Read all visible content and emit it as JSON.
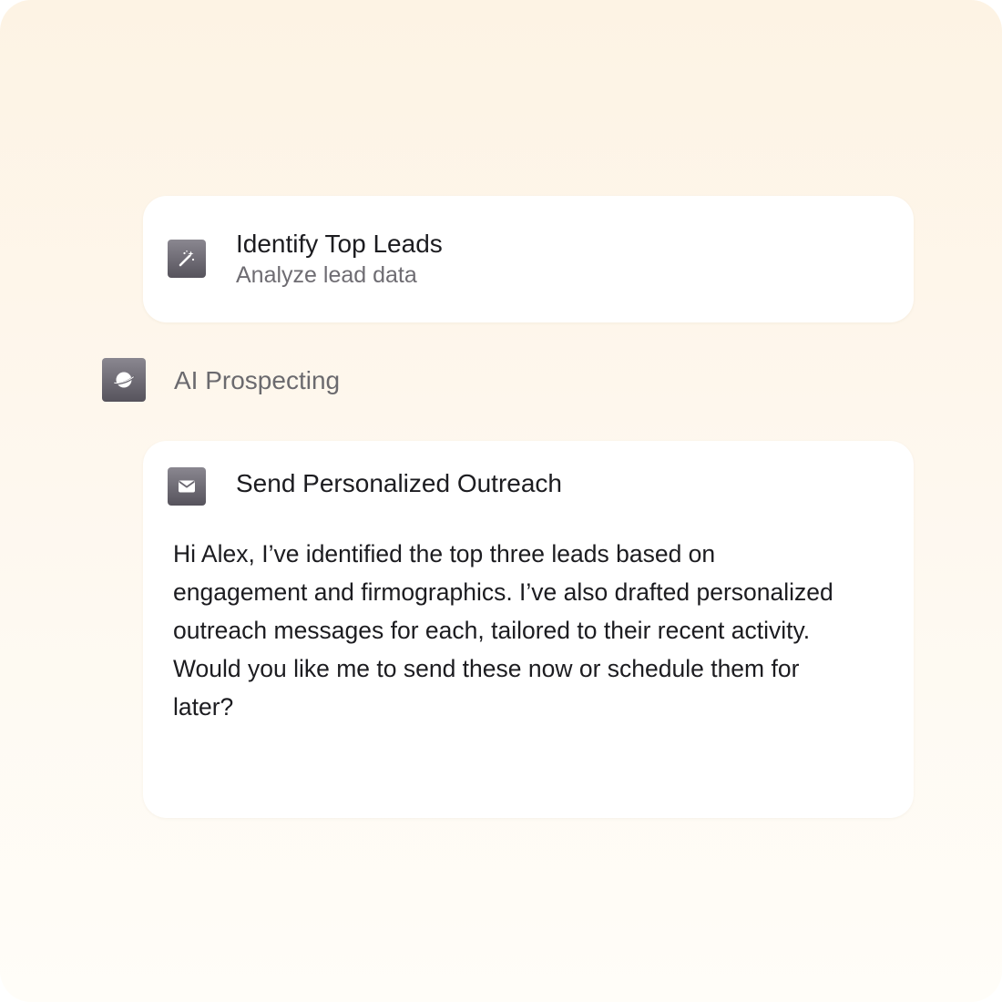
{
  "task_card": {
    "title": "Identify Top Leads",
    "subtitle": "Analyze lead data",
    "icon": "magic-wand-icon"
  },
  "agent": {
    "label": "AI Prospecting",
    "icon": "planet-icon"
  },
  "outreach_card": {
    "title": "Send Personalized Outreach",
    "icon": "mail-icon",
    "message": "Hi Alex, I’ve identified the top three leads based on engagement and firmographics. I’ve also drafted personalized outreach messages for each, tailored to their recent activity. Would you like me to send these now or schedule them for later?"
  },
  "colors": {
    "background_top": "#fdf3e4",
    "background_bottom": "#fffdf8",
    "card": "#ffffff",
    "icon_tile": "#6f6c75",
    "title_text": "#1c1c20",
    "muted_text": "#6e6c72"
  }
}
